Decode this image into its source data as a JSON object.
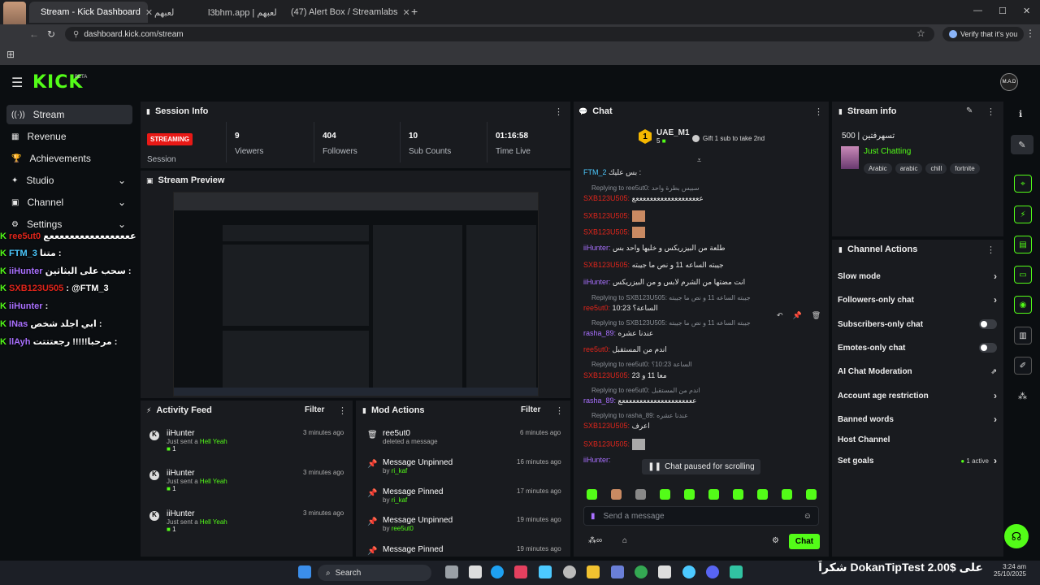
{
  "browser": {
    "tabs": [
      {
        "label": "Stream - Kick Dashboard",
        "active": true
      },
      {
        "label": "لعبهم",
        "active": false
      },
      {
        "label": "l3bhm.app | لعبهم",
        "active": false
      },
      {
        "label": "(47) Alert Box / Streamlabs",
        "active": false
      }
    ],
    "url": "dashboard.kick.com/stream",
    "profile_label": "Verify that it's you",
    "avatar_overlay": "12"
  },
  "nav": {
    "logo": "KICK",
    "beta": "BETA",
    "user_initials": "M.A.D"
  },
  "sidebar": {
    "items": [
      {
        "label": "Stream",
        "icon": "stream-icon",
        "active": true,
        "chev": ""
      },
      {
        "label": "Revenue",
        "icon": "revenue-icon",
        "active": false,
        "chev": ""
      },
      {
        "label": "Achievements",
        "icon": "trophy-icon",
        "active": false,
        "chev": ""
      },
      {
        "label": "Studio",
        "icon": "studio-icon",
        "active": false,
        "chev": "⌄"
      },
      {
        "label": "Channel",
        "icon": "channel-icon",
        "active": false,
        "chev": "⌄"
      },
      {
        "label": "Settings",
        "icon": "gear-icon",
        "active": false,
        "chev": "⌄"
      }
    ]
  },
  "overlay_chat": [
    {
      "user": "ree5ut0",
      "text": "عععععععععععععععععع",
      "color": "#e1251b"
    },
    {
      "user": "FTM_3",
      "text": "متنا :",
      "color": "#4cc9ff"
    },
    {
      "user": "iiHunter",
      "text": "سحب على البثاثين :",
      "color": "#a970ff"
    },
    {
      "user": "SXB123U505",
      "text": ": @FTM_3",
      "color": "#e1251b"
    },
    {
      "user": "iiHunter",
      "text": ":",
      "color": "#a970ff"
    },
    {
      "user": "INas",
      "text": "ابي اجلد شخص :",
      "color": "#a970ff"
    },
    {
      "user": "llAyh",
      "text": "مرحبا!!!!! رجعتتتت :",
      "color": "#a970ff"
    }
  ],
  "session": {
    "title": "Session Info",
    "status": "STREAMING",
    "status_label": "Session",
    "stats": [
      {
        "value": "9",
        "label": "Viewers"
      },
      {
        "value": "404",
        "label": "Followers"
      },
      {
        "value": "10",
        "label": "Sub Counts"
      },
      {
        "value": "01:16:58",
        "label": "Time Live"
      }
    ]
  },
  "preview": {
    "title": "Stream Preview"
  },
  "activity": {
    "title": "Activity Feed",
    "filter": "Filter",
    "items": [
      {
        "user": "iiHunter",
        "time": "3 minutes ago",
        "action": "Just sent a",
        "item": "Hell Yeah",
        "count": "1"
      },
      {
        "user": "iiHunter",
        "time": "3 minutes ago",
        "action": "Just sent a",
        "item": "Hell Yeah",
        "count": "1"
      },
      {
        "user": "iiHunter",
        "time": "3 minutes ago",
        "action": "Just sent a",
        "item": "Hell Yeah",
        "count": "1"
      }
    ]
  },
  "mod": {
    "title": "Mod Actions",
    "filter": "Filter",
    "items": [
      {
        "title": "ree5ut0",
        "sub": "deleted a message",
        "by": "",
        "time": "6 minutes ago"
      },
      {
        "title": "Message Unpinned",
        "sub": "by",
        "by": "ri_kaf",
        "time": "16 minutes ago"
      },
      {
        "title": "Message Pinned",
        "sub": "by",
        "by": "ri_kaf",
        "time": "17 minutes ago"
      },
      {
        "title": "Message Unpinned",
        "sub": "by",
        "by": "ree5ut0",
        "time": "19 minutes ago"
      },
      {
        "title": "Message Pinned",
        "sub": "",
        "by": "",
        "time": "19 minutes ago"
      }
    ]
  },
  "chat": {
    "title": "Chat",
    "gifter": "UAE_M1",
    "gifter_count": "5",
    "gift_text": "Gift 1 sub to take 2nd",
    "lines": [
      {
        "kind": "msg",
        "user": "FTM_2",
        "text": "بس عليك :",
        "cls": "u-blu"
      },
      {
        "kind": "reply",
        "text": "Replying to ree5ut0: سبيس بطرة واحد"
      },
      {
        "kind": "msg",
        "user": "SXB123U505:",
        "text": "عععععععععععععععععععع",
        "cls": "u-red"
      },
      {
        "kind": "msg",
        "user": "SXB123U505:",
        "text": "",
        "cls": "u-red"
      },
      {
        "kind": "msg",
        "user": "SXB123U505:",
        "text": "",
        "cls": "u-red"
      },
      {
        "kind": "msg",
        "user": "iiHunter:",
        "text": "طلعة من البيزريكس و خليها واحد بس",
        "cls": "u-pur"
      },
      {
        "kind": "msg",
        "user": "SXB123U505:",
        "text": "جيبته الساعه 11 و نص ما جيبته",
        "cls": "u-red"
      },
      {
        "kind": "msg",
        "user": "iiHunter:",
        "text": "انت مضتها من الشرم لابس و من البيزريكس",
        "cls": "u-pur"
      },
      {
        "kind": "reply",
        "text": "Replying to SXB123U505: جيبته الساعه 11 و نص ما جيبته"
      },
      {
        "kind": "msg",
        "user": "ree5ut0:",
        "text": "10:23 الساعة؟",
        "cls": "u-red"
      },
      {
        "kind": "reply",
        "text": "Replying to SXB123U505: جيبته الساعه 11 و نص ما جيبته"
      },
      {
        "kind": "msg",
        "user": "rasha_89:",
        "text": "عندنا عشره",
        "cls": "u-pur"
      },
      {
        "kind": "msg",
        "user": "ree5ut0:",
        "text": "اندم من المستقبل",
        "cls": "u-red"
      },
      {
        "kind": "reply",
        "text": "Replying to ree5ut0: الساعة 10:23؟"
      },
      {
        "kind": "msg",
        "user": "SXB123U505:",
        "text": "معا 11 و 23",
        "cls": "u-red"
      },
      {
        "kind": "reply",
        "text": "Replying to ree5ut0: اندم من المستقبل"
      },
      {
        "kind": "msg",
        "user": "rasha_89:",
        "text": "عععععععععععععععععععععع",
        "cls": "u-pur"
      },
      {
        "kind": "reply",
        "text": "Replying to rasha_89: عندنا عشره"
      },
      {
        "kind": "msg",
        "user": "SXB123U505:",
        "text": "اعرف",
        "cls": "u-red"
      },
      {
        "kind": "msg",
        "user": "SXB123U505:",
        "text": "",
        "cls": "u-red"
      },
      {
        "kind": "msg",
        "user": "iiHunter:",
        "text": "",
        "cls": "u-pur"
      }
    ],
    "paused": "Chat paused for scrolling",
    "placeholder": "Send a message",
    "send": "Chat"
  },
  "stream_info": {
    "title": "Stream info",
    "stream_title": "500 | تسهرفتين",
    "category": "Just Chatting",
    "tags": [
      "Arabic",
      "arabic",
      "chill",
      "fortnite"
    ]
  },
  "channel_actions": {
    "title": "Channel Actions",
    "rows": [
      {
        "label": "Slow mode",
        "type": "chevron",
        "extra": ""
      },
      {
        "label": "Followers-only chat",
        "type": "chevron",
        "extra": ""
      },
      {
        "label": "Subscribers-only chat",
        "type": "toggle",
        "extra": ""
      },
      {
        "label": "Emotes-only chat",
        "type": "toggle",
        "extra": ""
      },
      {
        "label": "AI Chat Moderation",
        "type": "ext",
        "extra": ""
      },
      {
        "label": "Account age restriction",
        "type": "chevron",
        "extra": ""
      },
      {
        "label": "Banned words",
        "type": "chevron",
        "extra": ""
      },
      {
        "label": "Host Channel",
        "type": "none",
        "extra": ""
      },
      {
        "label": "Set goals",
        "type": "chevron",
        "extra": "1 active"
      }
    ]
  },
  "taskbar": {
    "search": "Search",
    "tip_text": "شكراً DokanTipTest على $2.00",
    "time": "3:24 am",
    "date": "25/10/2025"
  },
  "colors": {
    "brand": "#53fc18",
    "live": "#e91916",
    "panel": "#191b1f"
  }
}
